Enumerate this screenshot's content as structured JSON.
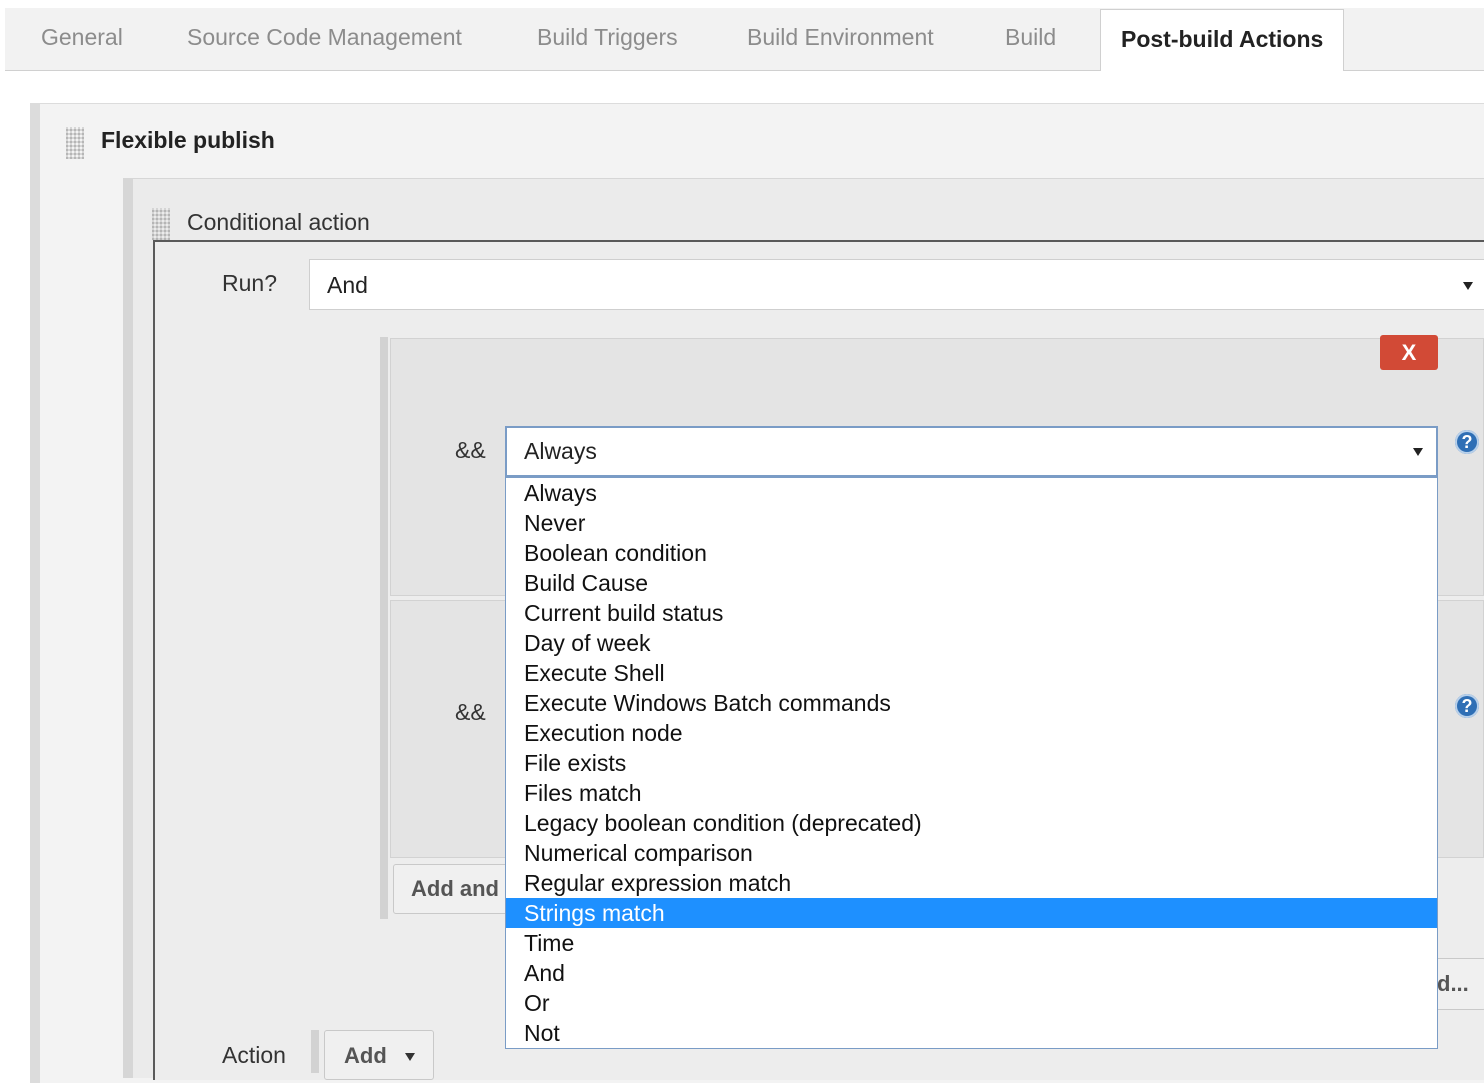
{
  "tabs": [
    {
      "label": "General",
      "active": false
    },
    {
      "label": "Source Code Management",
      "active": false
    },
    {
      "label": "Build Triggers",
      "active": false
    },
    {
      "label": "Build Environment",
      "active": false
    },
    {
      "label": "Build",
      "active": false
    },
    {
      "label": "Post-build Actions",
      "active": true
    }
  ],
  "section": {
    "title": "Flexible publish"
  },
  "conditional": {
    "title": "Conditional action",
    "run_label": "Run?",
    "run_value": "And"
  },
  "conditions": {
    "operator1": "&&",
    "operator2": "&&",
    "selected_value": "Always",
    "delete_label": "X",
    "help_glyph": "?",
    "add_and_label": "Add and",
    "add_partial_label": "d..."
  },
  "dropdown": {
    "options": [
      "Always",
      "Never",
      "Boolean condition",
      "Build Cause",
      "Current build status",
      "Day of week",
      "Execute Shell",
      "Execute Windows Batch commands",
      "Execution node",
      "File exists",
      "Files match",
      "Legacy boolean condition (deprecated)",
      "Numerical comparison",
      "Regular expression match",
      "Strings match",
      "Time",
      "And",
      "Or",
      "Not"
    ],
    "highlighted": "Strings match",
    "highlight_color": "#1e90ff"
  },
  "action": {
    "label": "Action",
    "add_label": "Add"
  },
  "colors": {
    "delete_button": "#d24a36",
    "help_icon": "#2f6fb5"
  }
}
